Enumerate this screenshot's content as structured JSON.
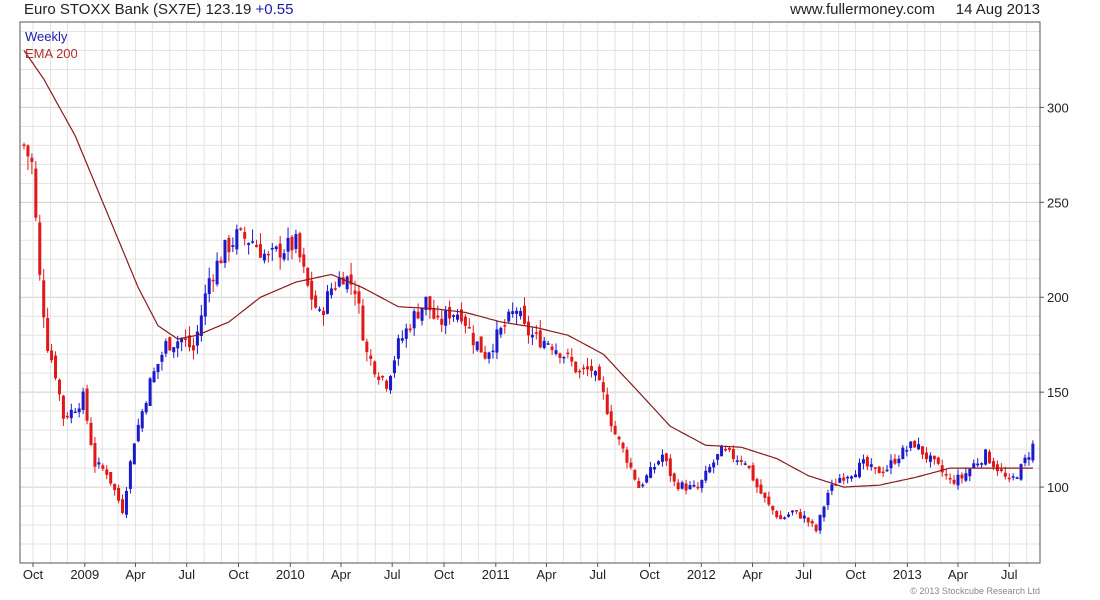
{
  "header": {
    "title": "Euro STOXX Bank (SX7E) 123.19",
    "change": "+0.55",
    "site": "www.fullermoney.com",
    "date": "14 Aug 2013"
  },
  "legend": {
    "interval": "Weekly",
    "ema": "EMA 200"
  },
  "copyright": "© 2013 Stockcube Research Ltd",
  "colors": {
    "up": "#1a1acc",
    "down": "#e01818",
    "ema": "#8b1a1a",
    "grid": "#e3e3e3"
  },
  "chart_data": {
    "type": "candlestick",
    "interval": "Weekly",
    "x_tick_labels": [
      "Oct",
      "2009",
      "Apr",
      "Jul",
      "Oct",
      "2010",
      "Apr",
      "Jul",
      "Oct",
      "2011",
      "Apr",
      "Jul",
      "Oct",
      "2012",
      "Apr",
      "Jul",
      "Oct",
      "2013",
      "Apr",
      "Jul"
    ],
    "y_ticks": [
      100,
      150,
      200,
      250,
      300
    ],
    "ylim": [
      60,
      345
    ],
    "y_axis_side": "right",
    "grid": true,
    "start_date": "2008-09-15",
    "end_date": "2013-08-14",
    "close_anchors": [
      [
        "2008-09-15",
        280
      ],
      [
        "2008-09-29",
        270
      ],
      [
        "2008-10-13",
        210
      ],
      [
        "2008-10-27",
        175
      ],
      [
        "2008-11-10",
        160
      ],
      [
        "2008-11-24",
        137
      ],
      [
        "2008-12-08",
        140
      ],
      [
        "2008-12-29",
        147
      ],
      [
        "2009-01-19",
        112
      ],
      [
        "2009-02-09",
        108
      ],
      [
        "2009-03-09",
        88
      ],
      [
        "2009-03-30",
        125
      ],
      [
        "2009-04-27",
        155
      ],
      [
        "2009-05-25",
        175
      ],
      [
        "2009-06-22",
        178
      ],
      [
        "2009-07-13",
        172
      ],
      [
        "2009-08-10",
        210
      ],
      [
        "2009-09-07",
        225
      ],
      [
        "2009-09-28",
        232
      ],
      [
        "2009-10-26",
        230
      ],
      [
        "2009-11-23",
        220
      ],
      [
        "2009-12-14",
        225
      ],
      [
        "2010-01-11",
        228
      ],
      [
        "2010-02-01",
        205
      ],
      [
        "2010-02-22",
        190
      ],
      [
        "2010-03-15",
        205
      ],
      [
        "2010-04-05",
        212
      ],
      [
        "2010-04-26",
        205
      ],
      [
        "2010-05-17",
        170
      ],
      [
        "2010-06-07",
        160
      ],
      [
        "2010-06-21",
        155
      ],
      [
        "2010-07-12",
        175
      ],
      [
        "2010-08-09",
        190
      ],
      [
        "2010-08-30",
        198
      ],
      [
        "2010-09-20",
        185
      ],
      [
        "2010-10-11",
        192
      ],
      [
        "2010-11-01",
        192
      ],
      [
        "2010-11-22",
        178
      ],
      [
        "2010-12-13",
        170
      ],
      [
        "2011-01-10",
        182
      ],
      [
        "2011-02-07",
        194
      ],
      [
        "2011-02-21",
        183
      ],
      [
        "2011-03-14",
        178
      ],
      [
        "2011-04-04",
        177
      ],
      [
        "2011-05-02",
        170
      ],
      [
        "2011-05-30",
        160
      ],
      [
        "2011-06-20",
        162
      ],
      [
        "2011-07-11",
        148
      ],
      [
        "2011-08-01",
        128
      ],
      [
        "2011-08-22",
        115
      ],
      [
        "2011-09-12",
        100
      ],
      [
        "2011-10-03",
        108
      ],
      [
        "2011-10-24",
        117
      ],
      [
        "2011-11-14",
        102
      ],
      [
        "2011-12-05",
        100
      ],
      [
        "2011-12-26",
        99
      ],
      [
        "2012-01-16",
        110
      ],
      [
        "2012-02-06",
        119
      ],
      [
        "2012-02-27",
        116
      ],
      [
        "2012-03-19",
        114
      ],
      [
        "2012-04-09",
        100
      ],
      [
        "2012-04-30",
        90
      ],
      [
        "2012-05-21",
        83
      ],
      [
        "2012-06-11",
        87
      ],
      [
        "2012-07-02",
        84
      ],
      [
        "2012-07-23",
        77
      ],
      [
        "2012-08-13",
        97
      ],
      [
        "2012-09-03",
        105
      ],
      [
        "2012-09-24",
        108
      ],
      [
        "2012-10-15",
        112
      ],
      [
        "2012-11-05",
        108
      ],
      [
        "2012-11-26",
        110
      ],
      [
        "2012-12-17",
        117
      ],
      [
        "2013-01-14",
        123
      ],
      [
        "2013-02-04",
        116
      ],
      [
        "2013-02-25",
        110
      ],
      [
        "2013-03-18",
        103
      ],
      [
        "2013-04-08",
        105
      ],
      [
        "2013-04-29",
        112
      ],
      [
        "2013-05-20",
        117
      ],
      [
        "2013-06-10",
        110
      ],
      [
        "2013-07-01",
        102
      ],
      [
        "2013-07-22",
        110
      ],
      [
        "2013-08-14",
        123
      ]
    ],
    "ema200_anchors": [
      [
        "2008-09-15",
        330
      ],
      [
        "2008-10-20",
        315
      ],
      [
        "2008-12-15",
        285
      ],
      [
        "2009-02-09",
        245
      ],
      [
        "2009-04-06",
        205
      ],
      [
        "2009-05-11",
        185
      ],
      [
        "2009-06-15",
        178
      ],
      [
        "2009-07-20",
        180
      ],
      [
        "2009-09-14",
        187
      ],
      [
        "2009-11-09",
        200
      ],
      [
        "2010-01-11",
        208
      ],
      [
        "2010-03-15",
        212
      ],
      [
        "2010-05-10",
        205
      ],
      [
        "2010-07-12",
        195
      ],
      [
        "2010-09-13",
        194
      ],
      [
        "2010-11-08",
        192
      ],
      [
        "2011-01-10",
        187
      ],
      [
        "2011-03-14",
        184
      ],
      [
        "2011-05-09",
        180
      ],
      [
        "2011-07-11",
        170
      ],
      [
        "2011-09-12",
        150
      ],
      [
        "2011-11-07",
        132
      ],
      [
        "2012-01-09",
        122
      ],
      [
        "2012-03-12",
        121
      ],
      [
        "2012-05-14",
        115
      ],
      [
        "2012-07-09",
        106
      ],
      [
        "2012-09-10",
        100
      ],
      [
        "2012-11-12",
        101
      ],
      [
        "2013-01-14",
        105
      ],
      [
        "2013-03-18",
        110
      ],
      [
        "2013-05-13",
        110
      ],
      [
        "2013-08-14",
        110
      ]
    ]
  }
}
